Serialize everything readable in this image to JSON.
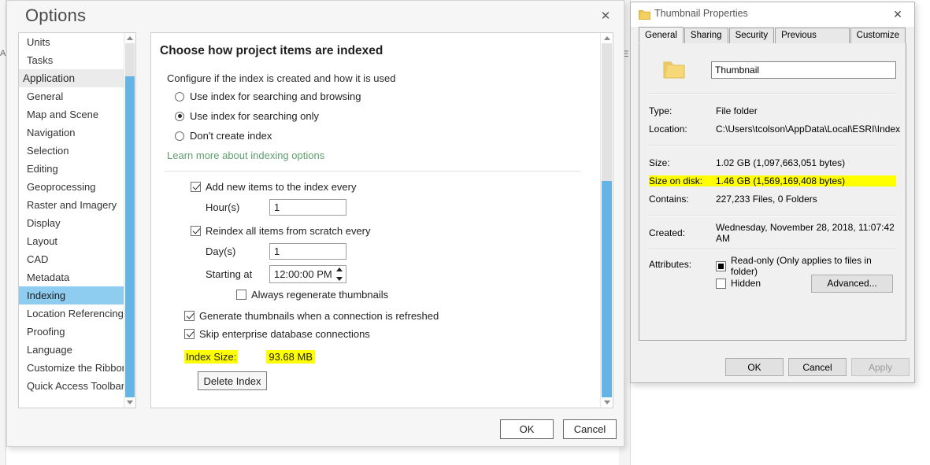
{
  "background": {
    "fragment_left": "A",
    "fragment_mid": "E"
  },
  "options_dialog": {
    "title": "Options",
    "close_icon": "close-icon",
    "nav": {
      "items": [
        {
          "label": "Units",
          "type": "item",
          "selected": false
        },
        {
          "label": "Tasks",
          "type": "item",
          "selected": false
        },
        {
          "label": "Application",
          "type": "group",
          "selected": false
        },
        {
          "label": "General",
          "type": "item",
          "selected": false
        },
        {
          "label": "Map and Scene",
          "type": "item",
          "selected": false
        },
        {
          "label": "Navigation",
          "type": "item",
          "selected": false
        },
        {
          "label": "Selection",
          "type": "item",
          "selected": false
        },
        {
          "label": "Editing",
          "type": "item",
          "selected": false
        },
        {
          "label": "Geoprocessing",
          "type": "item",
          "selected": false
        },
        {
          "label": "Raster and Imagery",
          "type": "item",
          "selected": false
        },
        {
          "label": "Display",
          "type": "item",
          "selected": false
        },
        {
          "label": "Layout",
          "type": "item",
          "selected": false
        },
        {
          "label": "CAD",
          "type": "item",
          "selected": false
        },
        {
          "label": "Metadata",
          "type": "item",
          "selected": false
        },
        {
          "label": "Indexing",
          "type": "item",
          "selected": true
        },
        {
          "label": "Location Referencing",
          "type": "item",
          "selected": false
        },
        {
          "label": "Proofing",
          "type": "item",
          "selected": false
        },
        {
          "label": "Language",
          "type": "item",
          "selected": false
        },
        {
          "label": "Customize the Ribbon",
          "type": "item",
          "selected": false
        },
        {
          "label": "Quick Access Toolbar",
          "type": "item",
          "selected": false
        }
      ]
    },
    "content": {
      "heading": "Choose how project items are indexed",
      "configure_label": "Configure if the index is created and how it is used",
      "radios": [
        {
          "label": "Use index for searching and browsing",
          "selected": false
        },
        {
          "label": "Use index for searching only",
          "selected": true
        },
        {
          "label": "Don't create index",
          "selected": false
        }
      ],
      "learn_more": "Learn more about indexing options",
      "add_items": {
        "label": "Add new items to the index every",
        "checked": true,
        "field_label": "Hour(s)",
        "field_value": "1"
      },
      "reindex": {
        "label": "Reindex all items from scratch every",
        "checked": true,
        "day_label": "Day(s)",
        "day_value": "1",
        "start_label": "Starting at",
        "start_value": "12:00:00 PM"
      },
      "always_regenerate": {
        "label": "Always regenerate thumbnails",
        "checked": false
      },
      "generate_thumbnails": {
        "label": "Generate thumbnails when a connection is refreshed",
        "checked": true
      },
      "skip_enterprise": {
        "label": "Skip enterprise database connections",
        "checked": true
      },
      "index_size": {
        "label": "Index Size:",
        "value": "93.68 MB",
        "highlight_color": "#ffff00"
      },
      "delete_index_button": "Delete Index"
    },
    "footer": {
      "ok": "OK",
      "cancel": "Cancel"
    }
  },
  "properties_dialog": {
    "title": "Thumbnail Properties",
    "close_icon": "close-icon",
    "folder_icon": "folder-icon",
    "tabs": [
      {
        "label": "General",
        "active": true
      },
      {
        "label": "Sharing",
        "active": false
      },
      {
        "label": "Security",
        "active": false
      },
      {
        "label": "Previous Versions",
        "active": false
      },
      {
        "label": "Customize",
        "active": false
      }
    ],
    "name_value": "Thumbnail",
    "rows": [
      {
        "key": "Type:",
        "value": "File folder",
        "highlight": false
      },
      {
        "key": "Location:",
        "value": "C:\\Users\\tcolson\\AppData\\Local\\ESRI\\Index",
        "highlight": false
      },
      {
        "key": "Size:",
        "value": "1.02 GB (1,097,663,051 bytes)",
        "highlight": false
      },
      {
        "key": "Size on disk:",
        "value": "1.46 GB (1,569,169,408 bytes)",
        "highlight": true
      },
      {
        "key": "Contains:",
        "value": "227,233 Files, 0 Folders",
        "highlight": false
      }
    ],
    "created": {
      "key": "Created:",
      "value": "Wednesday, November 28, 2018, 11:07:42 AM"
    },
    "attributes": {
      "key": "Attributes:",
      "readonly": {
        "label": "Read-only (Only applies to files in folder)",
        "state": "indeterminate"
      },
      "hidden": {
        "label": "Hidden",
        "state": "unchecked"
      },
      "advanced_button": "Advanced..."
    },
    "footer": {
      "ok": "OK",
      "cancel": "Cancel",
      "apply": "Apply",
      "apply_disabled": true
    }
  }
}
